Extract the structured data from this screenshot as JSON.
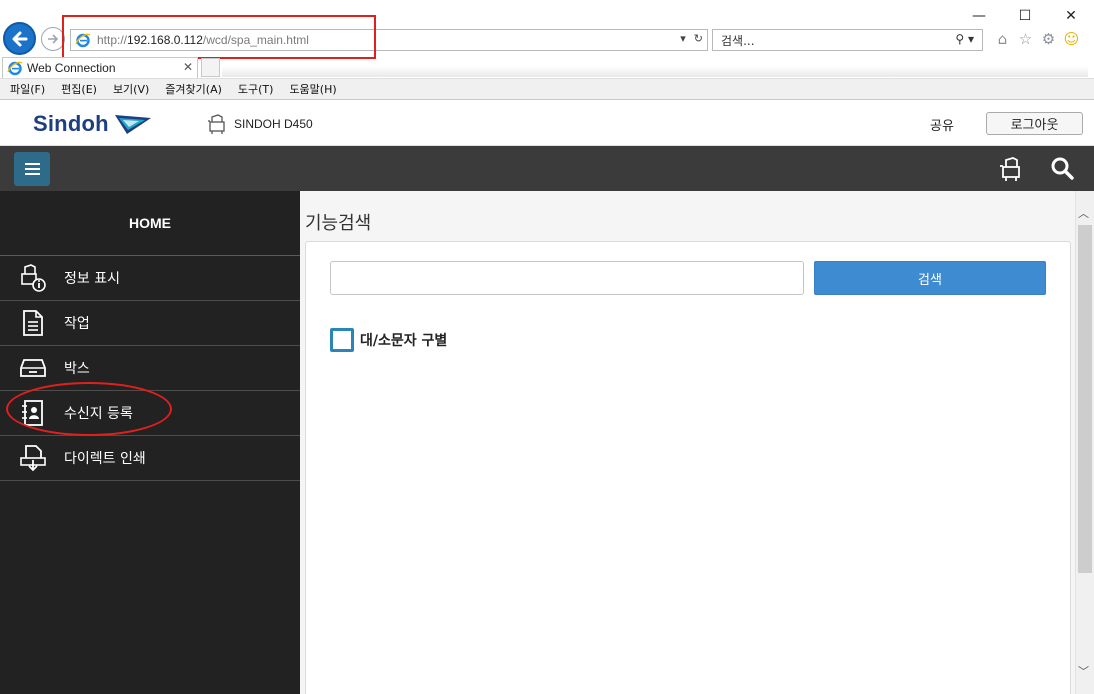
{
  "browser": {
    "url_prefix": "http://",
    "url_host": "192.168.0.112",
    "url_path": "/wcd/spa_main.html",
    "search_placeholder": "검색...",
    "tab_title": "Web Connection",
    "window_buttons": {
      "minimize": "—",
      "maximize": "☐",
      "close": "✕"
    },
    "menu": [
      "파일(F)",
      "편집(E)",
      "보기(V)",
      "즐겨찾기(A)",
      "도구(T)",
      "도움말(H)"
    ]
  },
  "header": {
    "brand": "Sindoh",
    "device_name": "SINDOH D450",
    "share_label": "공유",
    "logout_label": "로그아웃"
  },
  "sidebar": {
    "home_label": "HOME",
    "items": [
      {
        "label": "정보 표시",
        "icon": "device-info-icon"
      },
      {
        "label": "작업",
        "icon": "document-icon"
      },
      {
        "label": "박스",
        "icon": "tray-icon"
      },
      {
        "label": "수신지 등록",
        "icon": "address-book-icon"
      },
      {
        "label": "다이렉트 인쇄",
        "icon": "direct-print-icon"
      }
    ]
  },
  "main": {
    "title": "기능검색",
    "search_value": "",
    "search_button": "검색",
    "case_sensitive_label": "대/소문자 구별",
    "case_sensitive_checked": false
  },
  "annotations": {
    "highlight_color": "#e0201c"
  }
}
